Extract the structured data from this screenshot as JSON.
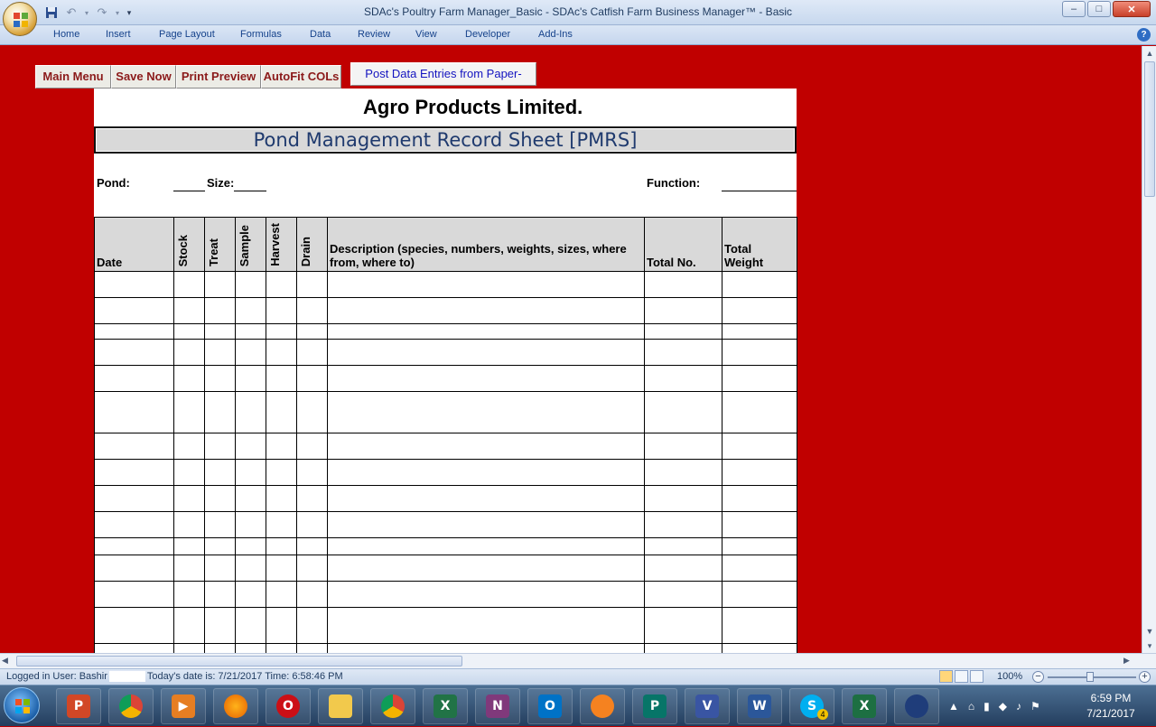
{
  "window": {
    "title": "SDAc's Poultry Farm Manager_Basic - SDAc's Catfish Farm Business Manager™ - Basic",
    "min": "–",
    "max": "□",
    "close": "✕"
  },
  "ribbon_tabs": [
    "Home",
    "Insert",
    "Page Layout",
    "Formulas",
    "Data",
    "Review",
    "View",
    "Developer",
    "Add-Ins"
  ],
  "help": "?",
  "macro_buttons": {
    "main_menu": "Main Menu",
    "save_now": "Save Now",
    "print_preview": "Print Preview",
    "autofit": "AutoFit COLs",
    "post_data": "Post Data Entries from Paper-"
  },
  "sheet": {
    "company_visible": "Agro Products Limited.",
    "record_title": "Pond Management Record Sheet [PMRS]",
    "pond_label": "Pond:",
    "size_label": "Size:",
    "function_label": "Function:",
    "columns": {
      "date": "Date",
      "stock": "Stock",
      "treat": "Treat",
      "sample": "Sample",
      "harvest": "Harvest",
      "drain": "Drain",
      "description_l1": "Description (species, numbers, weights, sizes, where",
      "description_l2": "from, where to)",
      "total_no": "Total No.",
      "total_weight_l1": "Total",
      "total_weight_l2": "Weight"
    }
  },
  "status": {
    "logged_in": "Logged in User: Bashir",
    "today": "Today's date is: 7/21/2017 Time: 6:58:46 PM",
    "zoom": "100%",
    "zoom_out": "−",
    "zoom_in": "+"
  },
  "taskbar": {
    "apps": [
      "PowerPoint",
      "Chrome",
      "Media Player",
      "Firefox",
      "Opera",
      "File Explorer",
      "Chrome",
      "Excel",
      "OneNote",
      "Outlook",
      "UC Browser",
      "Publisher",
      "Visio",
      "Word",
      "Skype",
      "Excel",
      "Media Center"
    ],
    "skype_badge": "4",
    "time": "6:59 PM",
    "date": "7/21/2017"
  }
}
